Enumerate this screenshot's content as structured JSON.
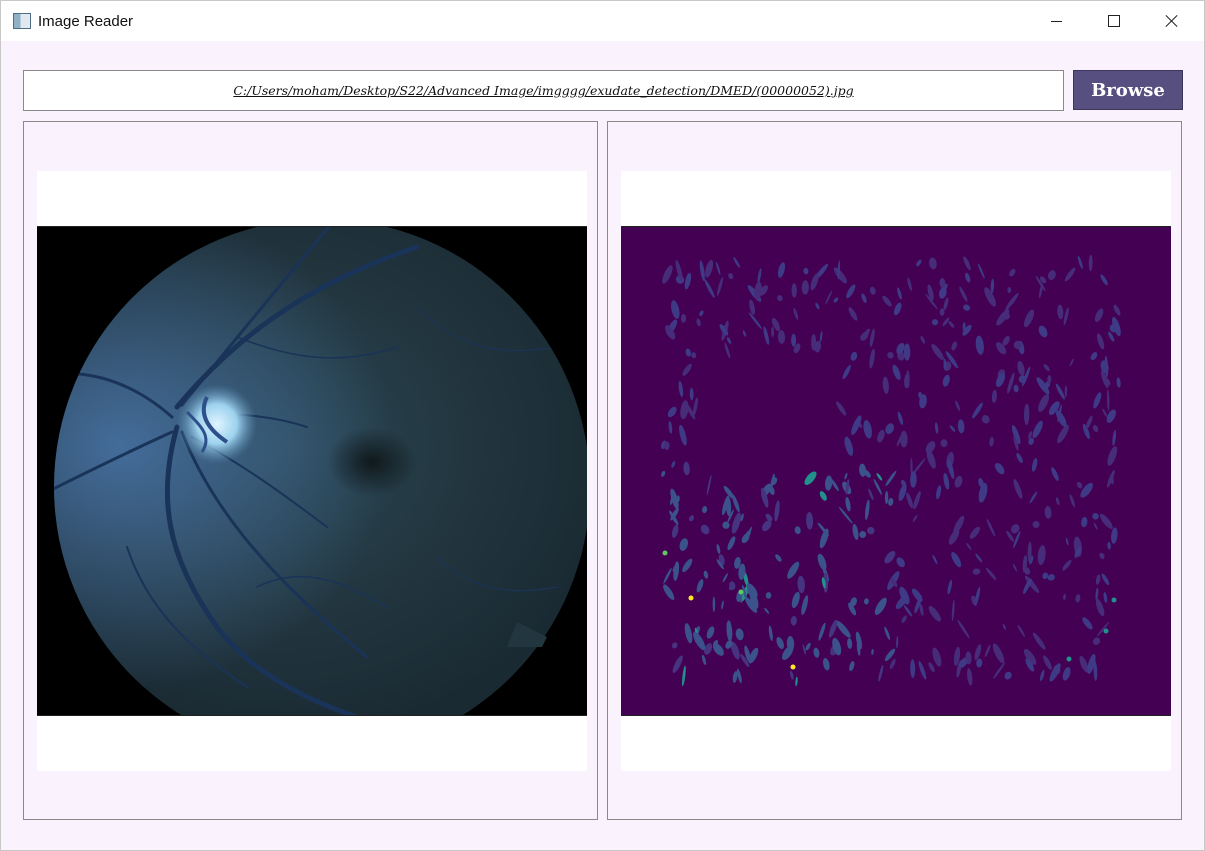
{
  "window": {
    "title": "Image Reader",
    "icon": "image-reader-app-icon",
    "controls": [
      "minimize-icon",
      "maximize-icon",
      "close-icon"
    ]
  },
  "toolbar": {
    "path_value": "C:/Users/moham/Desktop/S22/Advanced Image/imgggg/exudate_detection/DMED/(00000052).jpg",
    "browse_label": "Browse"
  },
  "panels": {
    "left": {
      "content": "retina fundus image"
    },
    "right": {
      "content": "exudate detection map"
    }
  },
  "colors": {
    "window_bg": "#faf2fd",
    "browse_bg": "#574f7f",
    "map_bg": "#440154",
    "map_low": "#3b528b",
    "map_mid": "#21918c",
    "map_high": "#5ec962",
    "map_peak": "#fde725"
  }
}
